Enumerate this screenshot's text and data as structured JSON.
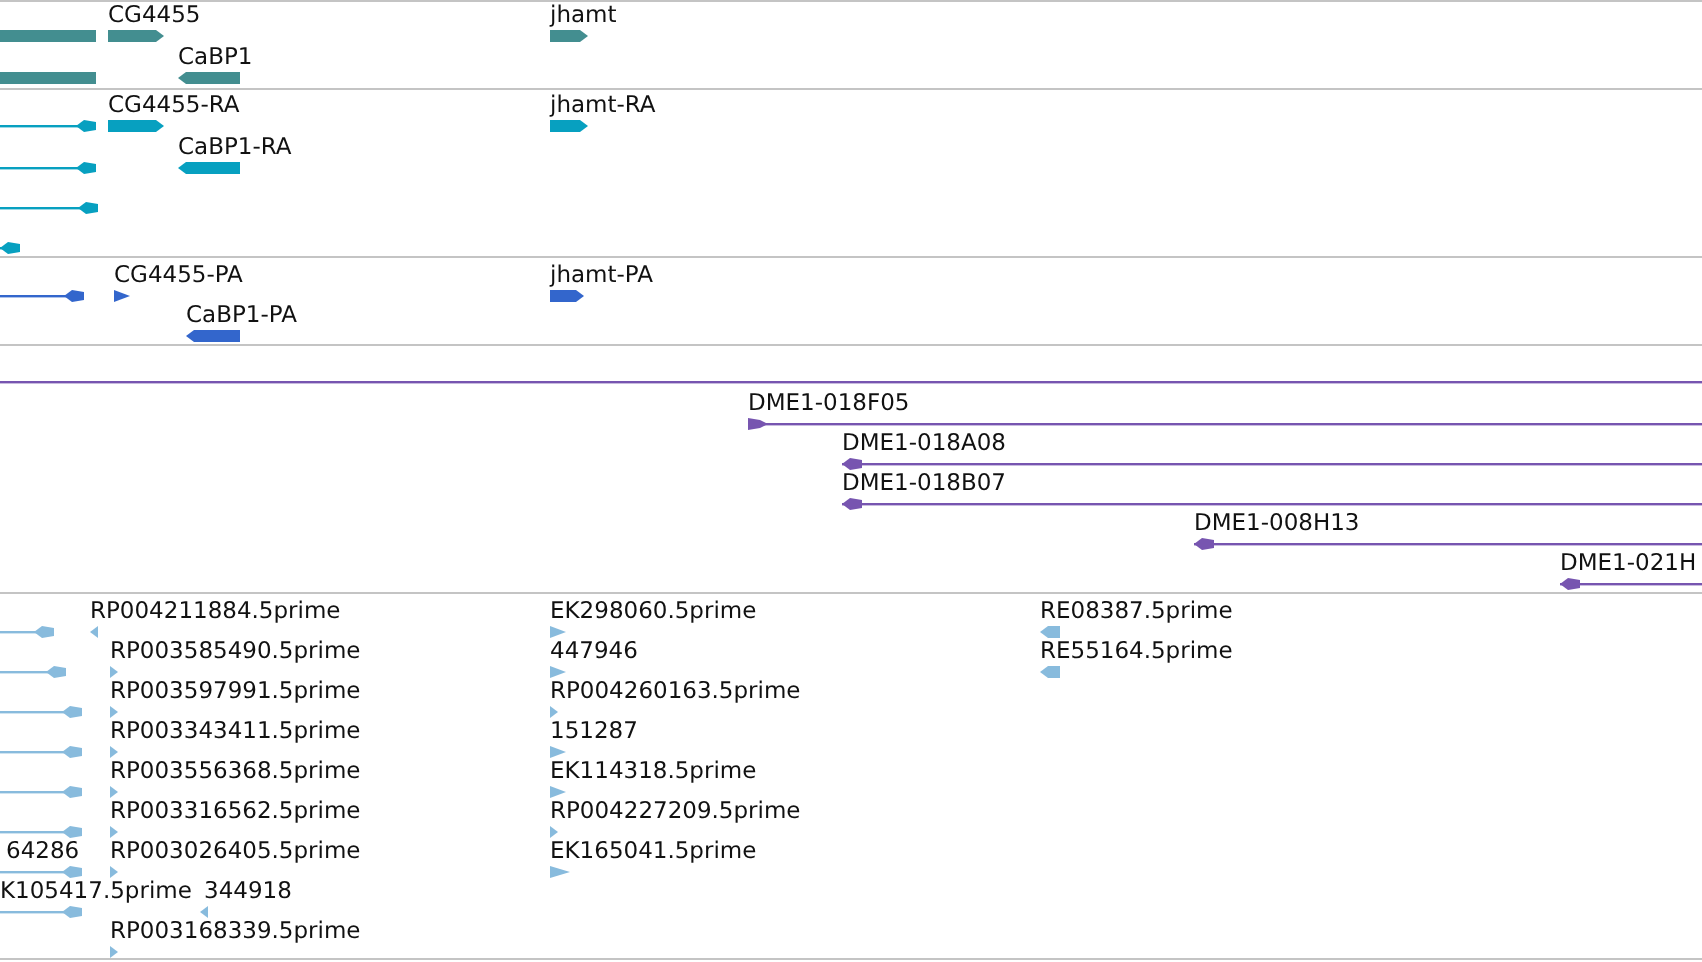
{
  "tracks": [
    {
      "features": [
        {
          "forward": false,
          "reverse": false
        },
        {
          "label": "CG4455",
          "forward": true,
          "reverse": false
        },
        {
          "label": "jhamt",
          "forward": true,
          "reverse": false
        },
        {
          "label": "CaBP1",
          "forward": false,
          "reverse": true
        },
        {
          "forward": false,
          "reverse": false
        }
      ]
    },
    {
      "features": [
        {
          "forward": false,
          "reverse": true
        },
        {
          "label": "CG4455-RA",
          "forward": true,
          "reverse": false
        },
        {
          "label": "jhamt-RA",
          "forward": true,
          "reverse": false
        },
        {
          "label": "CaBP1-RA",
          "forward": false,
          "reverse": true
        },
        {
          "forward": false,
          "reverse": true
        },
        {
          "forward": false,
          "reverse": true
        },
        {
          "forward": false,
          "reverse": true
        }
      ]
    },
    {
      "features": [
        {
          "forward": false,
          "reverse": true
        },
        {
          "label": "CG4455-PA",
          "forward": true,
          "reverse": false
        },
        {
          "label": "jhamt-PA",
          "forward": true,
          "reverse": false
        },
        {
          "label": "CaBP1-PA",
          "forward": false,
          "reverse": true
        }
      ]
    },
    {
      "features": [
        {
          "forward": false,
          "reverse": false
        },
        {
          "label": "DME1-018F05",
          "forward": true,
          "reverse": false
        },
        {
          "label": "DME1-018A08",
          "forward": false,
          "reverse": true
        },
        {
          "label": "DME1-018B07",
          "forward": false,
          "reverse": true
        },
        {
          "label": "DME1-008H13",
          "forward": false,
          "reverse": true
        },
        {
          "label": "DME1-021H",
          "forward": false,
          "reverse": true
        }
      ]
    },
    {
      "features": [
        {
          "forward": false,
          "reverse": true
        },
        {
          "label": "RP004211884.5prime",
          "forward": false,
          "reverse": true
        },
        {
          "label": "EK298060.5prime",
          "forward": true,
          "reverse": false
        },
        {
          "label": "RE08387.5prime",
          "forward": false,
          "reverse": true
        },
        {
          "forward": false,
          "reverse": true
        },
        {
          "label": "RP003585490.5prime",
          "forward": true,
          "reverse": false
        },
        {
          "label": "447946",
          "forward": true,
          "reverse": false
        },
        {
          "label": "RE55164.5prime",
          "forward": false,
          "reverse": true
        },
        {
          "forward": false,
          "reverse": true
        },
        {
          "label": "RP003597991.5prime",
          "forward": true,
          "reverse": false
        },
        {
          "label": "RP004260163.5prime",
          "forward": true,
          "reverse": false
        },
        {
          "forward": false,
          "reverse": true
        },
        {
          "label": "RP003343411.5prime",
          "forward": true,
          "reverse": false
        },
        {
          "label": "151287",
          "forward": true,
          "reverse": false
        },
        {
          "forward": false,
          "reverse": true
        },
        {
          "label": "RP003556368.5prime",
          "forward": true,
          "reverse": false
        },
        {
          "label": "EK114318.5prime",
          "forward": true,
          "reverse": false
        },
        {
          "forward": false,
          "reverse": true
        },
        {
          "label": "RP003316562.5prime",
          "forward": true,
          "reverse": false
        },
        {
          "label": "RP004227209.5prime",
          "forward": true,
          "reverse": false
        },
        {
          "label": "64286",
          "forward": false,
          "reverse": true
        },
        {
          "label": "RP003026405.5prime",
          "forward": true,
          "reverse": false
        },
        {
          "label": "EK165041.5prime",
          "forward": true,
          "reverse": false
        },
        {
          "label": "K105417.5prime",
          "forward": false,
          "reverse": true
        },
        {
          "label": "344918",
          "forward": false,
          "reverse": true
        },
        {
          "label": "RP003168339.5prime",
          "forward": true,
          "reverse": false
        }
      ]
    }
  ]
}
